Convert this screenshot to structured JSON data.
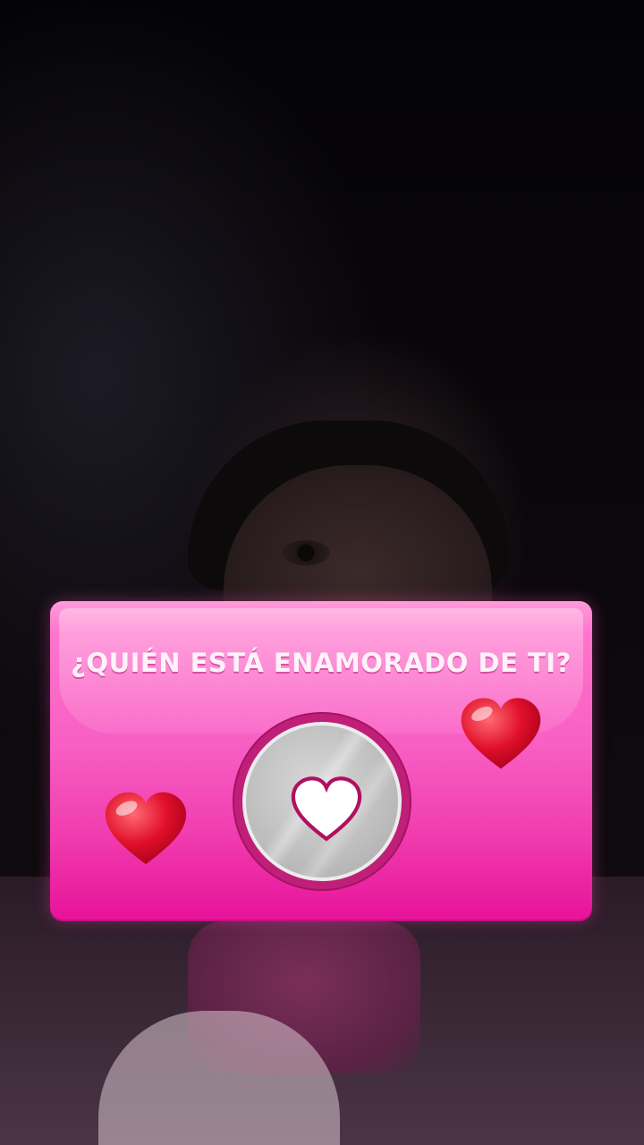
{
  "overlay": {
    "title": "¿QUIÉN ESTÁ ENAMORADO DE TI?"
  },
  "icons": {
    "left_heart": "red-heart-icon",
    "right_heart": "red-heart-icon",
    "center_heart": "white-heart-icon"
  },
  "colors": {
    "card_top": "#ff8ad5",
    "card_bottom": "#e8139a",
    "title": "#fff2fa",
    "heart_red": "#e0102a",
    "spinner_gray": "#bdbdbd"
  }
}
